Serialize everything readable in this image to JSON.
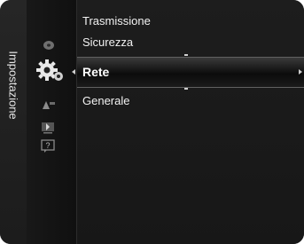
{
  "menu": {
    "section_title": "Impostazione",
    "items": [
      {
        "label": "Trasmissione"
      },
      {
        "label": "Sicurezza"
      },
      {
        "label": "Rete",
        "selected": true
      },
      {
        "label": "Generale"
      }
    ]
  },
  "icons": {
    "side": [
      "disc-icon",
      "settings-gear-icon",
      "input-source-icon",
      "application-icon",
      "help-icon"
    ]
  },
  "colors": {
    "background": "#222222",
    "text": "#f2f2f2",
    "selection_text": "#ffffff"
  }
}
